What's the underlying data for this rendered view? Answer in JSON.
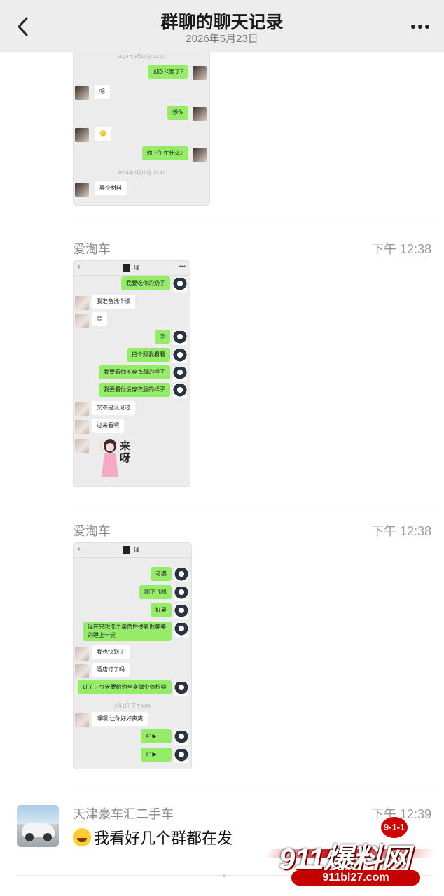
{
  "header": {
    "title": "群聊的聊天记录",
    "date": "2026年5月23日"
  },
  "screenshot1": {
    "messages": [
      {
        "kind": "ts",
        "text": "2024年5月10日 12:31"
      },
      {
        "kind": "out",
        "text": "回办公室了?"
      },
      {
        "kind": "in",
        "text": "嗯"
      },
      {
        "kind": "out",
        "text": "想你"
      },
      {
        "kind": "in",
        "text": "🙂"
      },
      {
        "kind": "out",
        "text": "你下午忙什么?"
      },
      {
        "kind": "ts",
        "text": "2024年5月10日 12:41"
      },
      {
        "kind": "in",
        "text": "弄个材料"
      }
    ]
  },
  "messages": [
    {
      "sender": "爱淘车",
      "time": "下午 12:38",
      "shot_title": "瑾",
      "bubbles": [
        {
          "kind": "out",
          "text": "我要吃你的奶子"
        },
        {
          "kind": "in",
          "text": "我准备洗个澡"
        },
        {
          "kind": "in",
          "text": "😊"
        },
        {
          "kind": "out",
          "text": "😡"
        },
        {
          "kind": "out",
          "text": "拍个照我看看"
        },
        {
          "kind": "out",
          "text": "我要看你不穿衣服的样子"
        },
        {
          "kind": "out",
          "text": "我要看你没穿衣服的样子"
        },
        {
          "kind": "in",
          "text": "又不是没见过"
        },
        {
          "kind": "in",
          "text": "过来看啊"
        }
      ],
      "sticker_text": "来呀"
    },
    {
      "sender": "爱淘车",
      "time": "下午 12:38",
      "shot_title": "瑾",
      "bubbles": [
        {
          "kind": "out",
          "text": "老婆"
        },
        {
          "kind": "out",
          "text": "刚下飞机"
        },
        {
          "kind": "out",
          "text": "好累"
        },
        {
          "kind": "out",
          "text": "现在只想洗个澡然后搂着你美美的睡上一觉"
        },
        {
          "kind": "in",
          "text": "我也快到了"
        },
        {
          "kind": "in",
          "text": "酒店订了吗"
        },
        {
          "kind": "out",
          "text": "订了，今天要给你全身做个体检😁"
        },
        {
          "kind": "ts",
          "text": "2月1日 下午6:04"
        },
        {
          "kind": "in",
          "text": "嘿嘿 让你好好爽爽"
        },
        {
          "kind": "out",
          "text": "4\" ▶"
        },
        {
          "kind": "out",
          "text": "6\" ▶"
        }
      ]
    },
    {
      "sender": "天津豪车汇二手车",
      "time": "下午 12:39",
      "text": "我看好几个群都在发",
      "emoji": "joy-emoji"
    }
  ],
  "watermark": {
    "badge": "9-1-1",
    "brand": "911爆料网",
    "url": "911bl27.com"
  }
}
